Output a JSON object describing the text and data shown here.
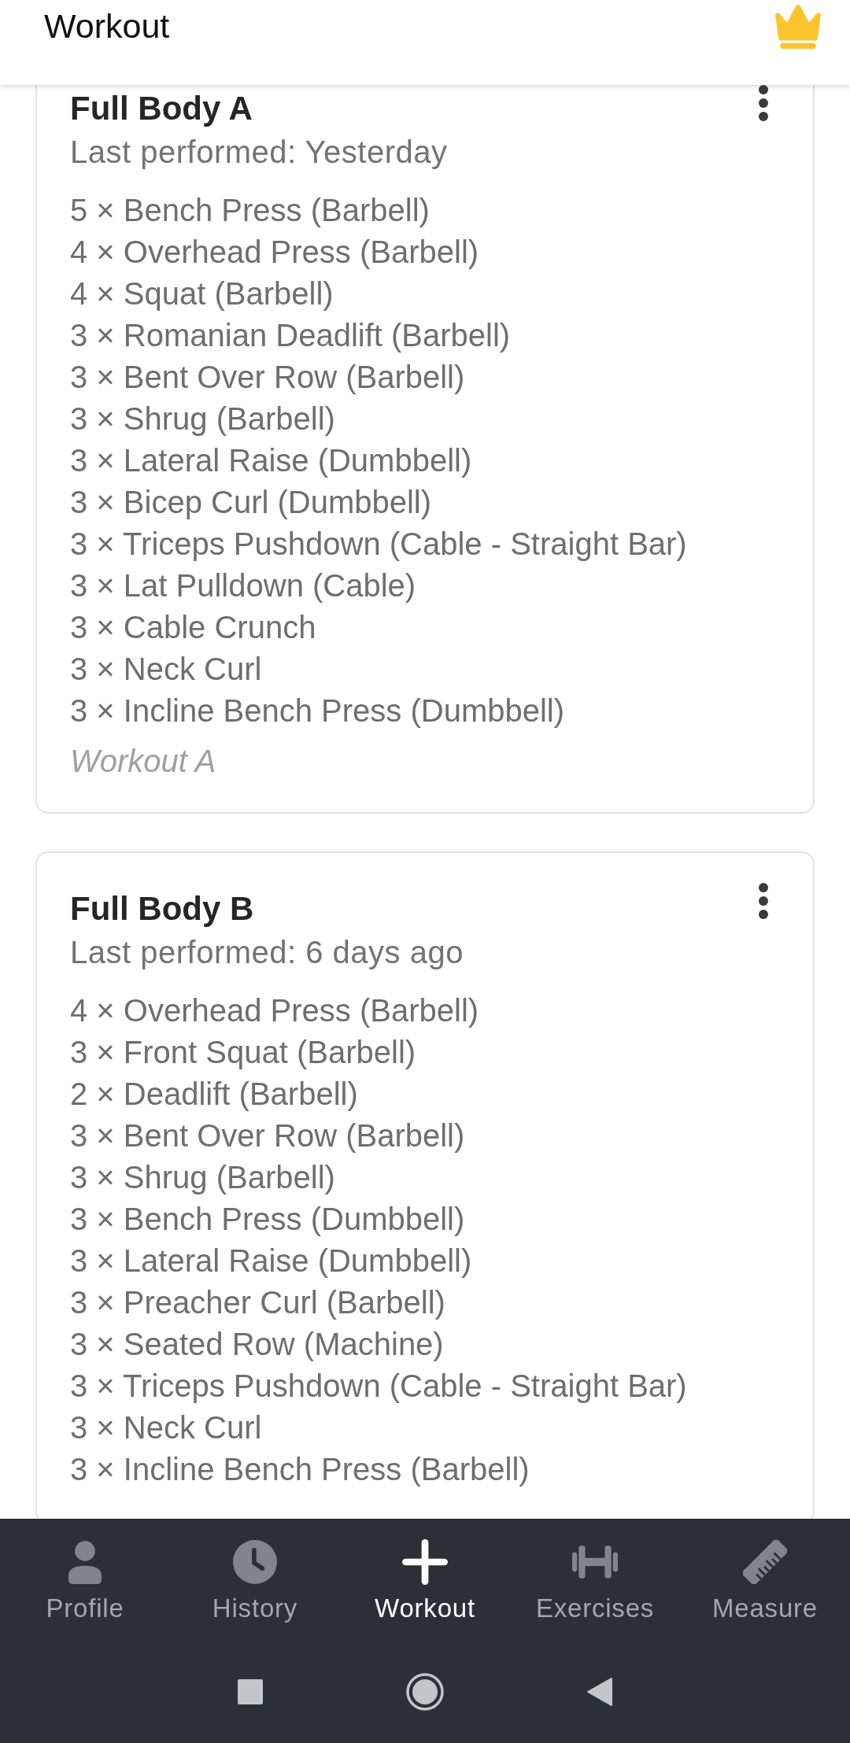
{
  "app_bar": {
    "title": "Workout"
  },
  "templates": [
    {
      "title": "Full Body A",
      "last_performed": "Last performed: Yesterday",
      "exercises": [
        "5 × Bench Press (Barbell)",
        "4 × Overhead Press (Barbell)",
        "4 × Squat (Barbell)",
        "3 × Romanian Deadlift (Barbell)",
        "3 × Bent Over Row (Barbell)",
        "3 × Shrug (Barbell)",
        "3 × Lateral Raise (Dumbbell)",
        "3 × Bicep Curl (Dumbbell)",
        "3 × Triceps Pushdown (Cable - Straight Bar)",
        "3 × Lat Pulldown (Cable)",
        "3 × Cable Crunch",
        "3 × Neck Curl",
        "3 × Incline Bench Press (Dumbbell)"
      ],
      "note": "Workout A"
    },
    {
      "title": "Full Body B",
      "last_performed": "Last performed: 6 days ago",
      "exercises": [
        "4 × Overhead Press (Barbell)",
        "3 × Front Squat (Barbell)",
        "2 × Deadlift (Barbell)",
        "3 × Bent Over Row (Barbell)",
        "3 × Shrug (Barbell)",
        "3 × Bench Press (Dumbbell)",
        "3 × Lateral Raise (Dumbbell)",
        "3 × Preacher Curl (Barbell)",
        "3 × Seated Row (Machine)",
        "3 × Triceps Pushdown (Cable - Straight Bar)",
        "3 × Neck Curl",
        "3 × Incline Bench Press (Barbell)"
      ]
    }
  ],
  "bottom_nav": [
    {
      "label": "Profile",
      "kind": "profile",
      "selected": false
    },
    {
      "label": "History",
      "kind": "history",
      "selected": false
    },
    {
      "label": "Workout",
      "kind": "workout",
      "selected": true
    },
    {
      "label": "Exercises",
      "kind": "exercises",
      "selected": false
    },
    {
      "label": "Measure",
      "kind": "measure",
      "selected": false
    }
  ]
}
